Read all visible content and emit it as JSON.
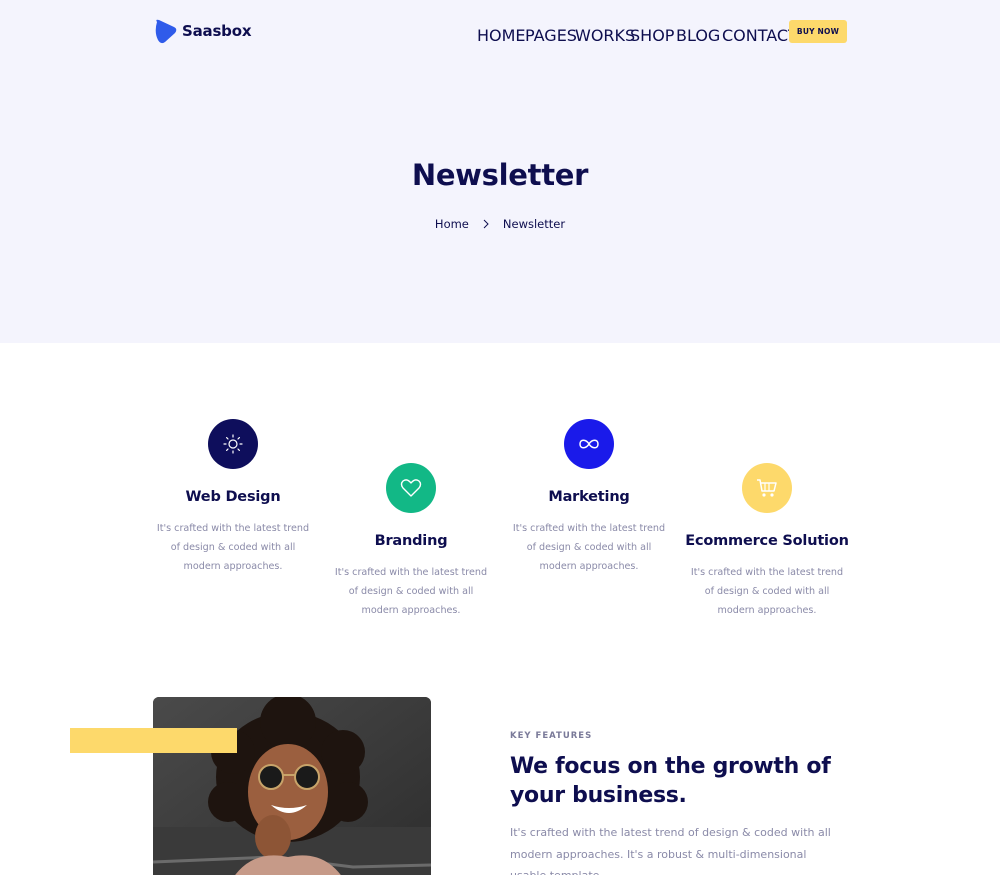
{
  "brand": {
    "name": "Saasbox",
    "color": "#2f5bea"
  },
  "nav": {
    "items": [
      "HOME",
      "PAGES",
      "WORKS",
      "SHOP",
      "BLOG",
      "CONTACT"
    ],
    "cta": "BUY NOW"
  },
  "hero": {
    "title": "Newsletter",
    "breadcrumb": [
      "Home",
      "Newsletter"
    ]
  },
  "services": [
    {
      "title": "Web Design",
      "description": "It's crafted with the latest trend of design & coded with all modern approaches.",
      "icon": "sun-icon",
      "color": "#0e0e5c"
    },
    {
      "title": "Branding",
      "description": "It's crafted with the latest trend of design & coded with all modern approaches.",
      "icon": "heart-icon",
      "color": "#12b886"
    },
    {
      "title": "Marketing",
      "description": "It's crafted with the latest trend of design & coded with all modern approaches.",
      "icon": "infinity-icon",
      "color": "#1a1aea"
    },
    {
      "title": "Ecommerce Solution",
      "description": "It's crafted with the latest trend of design & coded with all modern approaches.",
      "icon": "cart-icon",
      "color": "#fdd96b"
    }
  ],
  "features": {
    "label": "KEY FEATURES",
    "title": "We focus on the growth of your business.",
    "description": "It's crafted with the latest trend of design & coded with all modern approaches. It's a robust & multi-dimensional usable template."
  },
  "colors": {
    "navy": "#0e0e4f",
    "hero_bg": "#f4f4fd",
    "accent_yellow": "#fdd96b"
  }
}
